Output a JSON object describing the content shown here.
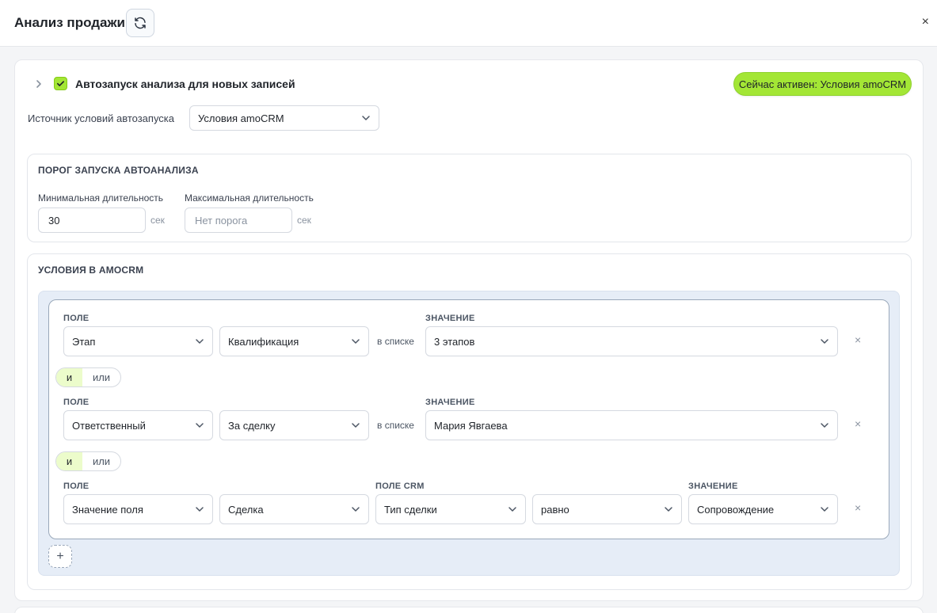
{
  "header": {
    "title": "Анализ продажи",
    "close_glyph": "×"
  },
  "icons": {
    "refresh": "refresh-icon",
    "close": "close-icon",
    "expand": "chevron-right-icon",
    "check": "check-icon",
    "dropdown": "chevron-down-icon",
    "remove": "close-icon",
    "add": "plus-icon"
  },
  "autostart": {
    "checked": true,
    "label": "Автозапуск анализа для новых записей",
    "active_badge": "Сейчас активен: Условия amoCRM",
    "source_label": "Источник условий автозапуска",
    "source_value": "Условия amoCRM"
  },
  "threshold": {
    "heading": "ПОРОГ ЗАПУСКА АВТОАНАЛИЗА",
    "min_label": "Минимальная длительность",
    "min_value": "30",
    "max_label": "Максимальная длительность",
    "max_placeholder": "Нет порога",
    "unit": "сек"
  },
  "conditions": {
    "heading": "УСЛОВИЯ В AMOCRM",
    "and_label": "и",
    "or_label": "или",
    "add_glyph": "+",
    "remove_glyph": "×",
    "rows": [
      {
        "field_caption": "ПОЛЕ",
        "field": "Этап",
        "sub": "Квалификация",
        "operator": "в списке",
        "value_caption": "ЗНАЧЕНИЕ",
        "value": "3 этапов"
      },
      {
        "field_caption": "ПОЛЕ",
        "field": "Ответственный",
        "sub": "За сделку",
        "operator": "в списке",
        "value_caption": "ЗНАЧЕНИЕ",
        "value": "Мария Явгаева"
      },
      {
        "field_caption": "ПОЛЕ",
        "field": "Значение поля",
        "entity": "Сделка",
        "crm_caption": "ПОЛЕ CRM",
        "crm_field": "Тип сделки",
        "operator": "равно",
        "value_caption": "ЗНАЧЕНИЕ",
        "value": "Сопровождение"
      }
    ],
    "connectors": [
      {
        "selected": "и"
      },
      {
        "selected": "и"
      }
    ]
  },
  "colors": {
    "accent": "#a3e635",
    "accent_soft": "#ecfccb",
    "panel_bg": "#e6edf7"
  }
}
